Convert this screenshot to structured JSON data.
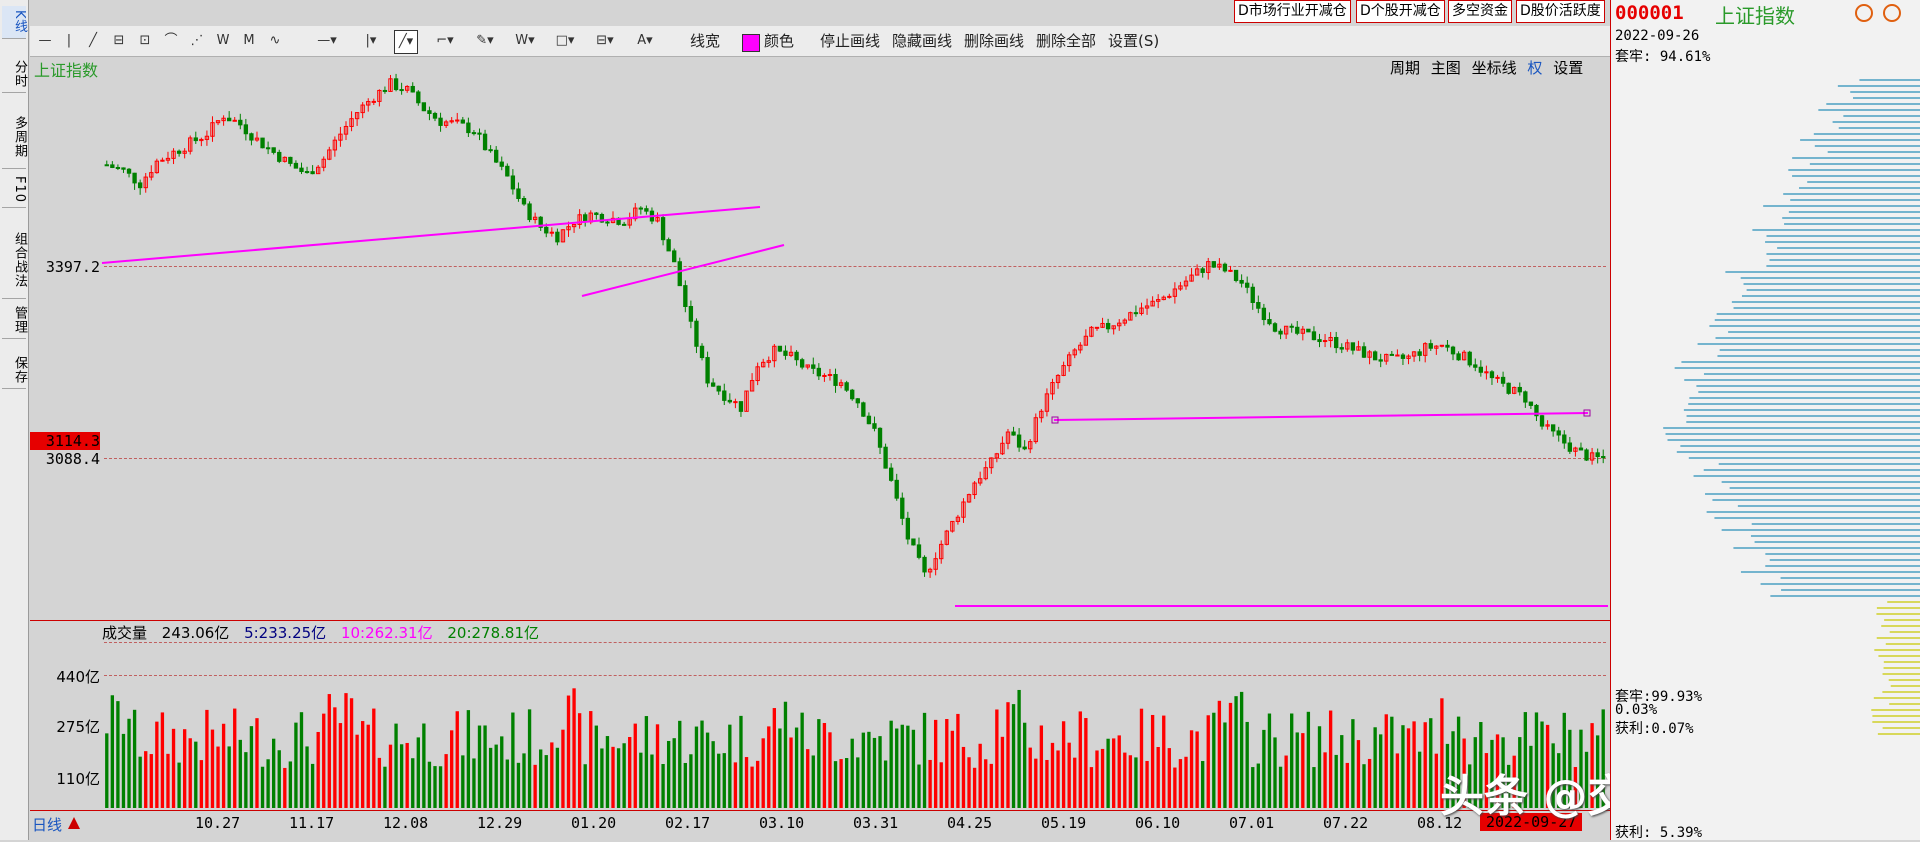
{
  "left_tabs": [
    "K线",
    "分时",
    "多周期",
    "F10",
    "组合战法",
    "管理",
    "保存"
  ],
  "toolbar": {
    "items": [
      "线宽",
      "颜色",
      "停止画线",
      "隐藏画线",
      "删除画线",
      "删除全部",
      "设置(S)"
    ],
    "line_color": "#ff00ff"
  },
  "top_buttons": [
    "D市场行业开减仓",
    "D个股开减仓",
    "多空资金",
    "D股价活跃度"
  ],
  "chart_header": {
    "index_name": "上证指数",
    "right_links": [
      "周期",
      "主图",
      "坐标线",
      "权",
      "设置"
    ]
  },
  "right_panel": {
    "code": "000001",
    "name": "上证指数",
    "date": "2022-09-26",
    "tao_lao_top": "套牢: 94.61%",
    "tao_lao_bottom": "套牢:99.93%",
    "mid_pct": "0.03%",
    "profit": "获利:0.07%",
    "profit_bottom": "获利: 5.39%"
  },
  "volume_header": {
    "label": "成交量",
    "value": "243.06亿",
    "ma5": "5:233.25亿",
    "ma10": "10:262.31亿",
    "ma20": "20:278.81亿"
  },
  "bottom_bar": {
    "period": "日线",
    "current_date": "2022-09-27"
  },
  "watermark": "头条 @交易员future",
  "colors": {
    "up": "#ff0000",
    "down": "#008000",
    "drawn_line": "#ff00ff",
    "ma5": "#000080",
    "ma10": "#ff00ff",
    "ma20": "#008000"
  },
  "chart_data": {
    "type": "candlestick",
    "title": "上证指数",
    "price_labels": [
      "3397.2",
      "3114.3",
      "3088.4"
    ],
    "current_price": 3114.3,
    "x_ticks": [
      "10.27",
      "11.17",
      "12.08",
      "12.29",
      "01.20",
      "02.17",
      "03.10",
      "03.31",
      "04.25",
      "05.19",
      "06.10",
      "07.01",
      "07.22",
      "08.12"
    ],
    "volume_ticks": [
      "440亿",
      "275亿",
      "110亿"
    ],
    "price_series": [
      3560,
      3550,
      3530,
      3565,
      3580,
      3595,
      3610,
      3640,
      3625,
      3600,
      3580,
      3560,
      3545,
      3570,
      3610,
      3645,
      3670,
      3690,
      3680,
      3650,
      3630,
      3625,
      3615,
      3575,
      3540,
      3490,
      3460,
      3445,
      3470,
      3480,
      3475,
      3470,
      3490,
      3470,
      3400,
      3300,
      3215,
      3190,
      3170,
      3240,
      3260,
      3250,
      3230,
      3220,
      3210,
      3180,
      3130,
      3050,
      2960,
      2900,
      2950,
      3000,
      3050,
      3080,
      3130,
      3100,
      3170,
      3220,
      3260,
      3290,
      3300,
      3315,
      3330,
      3340,
      3360,
      3380,
      3400,
      3390,
      3370,
      3330,
      3300,
      3290,
      3285,
      3280,
      3270,
      3260,
      3250,
      3245,
      3250,
      3265,
      3270,
      3255,
      3240,
      3215,
      3200,
      3185,
      3140,
      3120,
      3100,
      3088
    ]
  }
}
